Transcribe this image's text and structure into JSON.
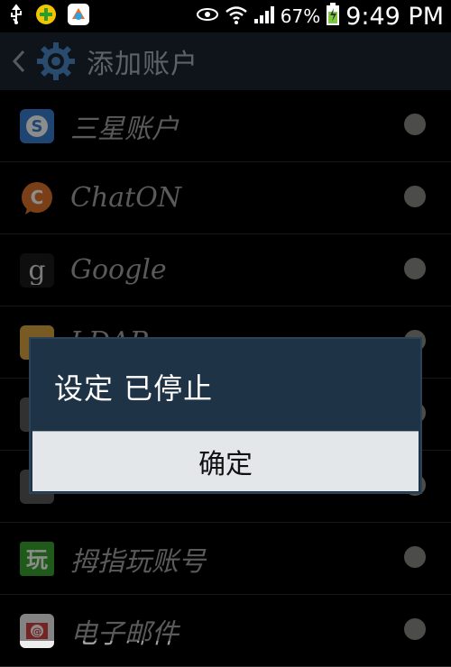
{
  "status_bar": {
    "icons": [
      "usb-icon",
      "plus-app-icon",
      "colorful-app-icon",
      "eye-icon",
      "wifi-icon",
      "signal-icon",
      "battery-charging-icon"
    ],
    "battery": "67%",
    "time": "9:49 PM"
  },
  "action_bar": {
    "title": "添加账户",
    "back_icon": "chevron-left-icon",
    "app_icon": "gear-icon"
  },
  "accounts": [
    {
      "label": "三星账户",
      "icon": "samsung-account-icon",
      "color": "#3a7fd0"
    },
    {
      "label": "ChatON",
      "icon": "chaton-icon",
      "color": "#e0742a"
    },
    {
      "label": "Google",
      "icon": "google-icon",
      "color": "#202020"
    },
    {
      "label": "LDAP",
      "icon": "ldap-icon",
      "color": "#d9a640"
    },
    {
      "label": "",
      "icon": "account-icon",
      "color": "#5a5a5a"
    },
    {
      "label": "",
      "icon": "account-icon",
      "color": "#5a5a5a"
    },
    {
      "label": "拇指玩账号",
      "icon": "muzhiwan-icon",
      "color": "#3aa431"
    },
    {
      "label": "电子邮件",
      "icon": "email-icon",
      "color": "#d84040"
    }
  ],
  "dialog": {
    "message": "设定 已停止",
    "button": "确定"
  },
  "colors": {
    "action_bar_bg": "#1c2631",
    "dialog_bg": "#1f3346",
    "button_bg": "#e3e7ea"
  }
}
